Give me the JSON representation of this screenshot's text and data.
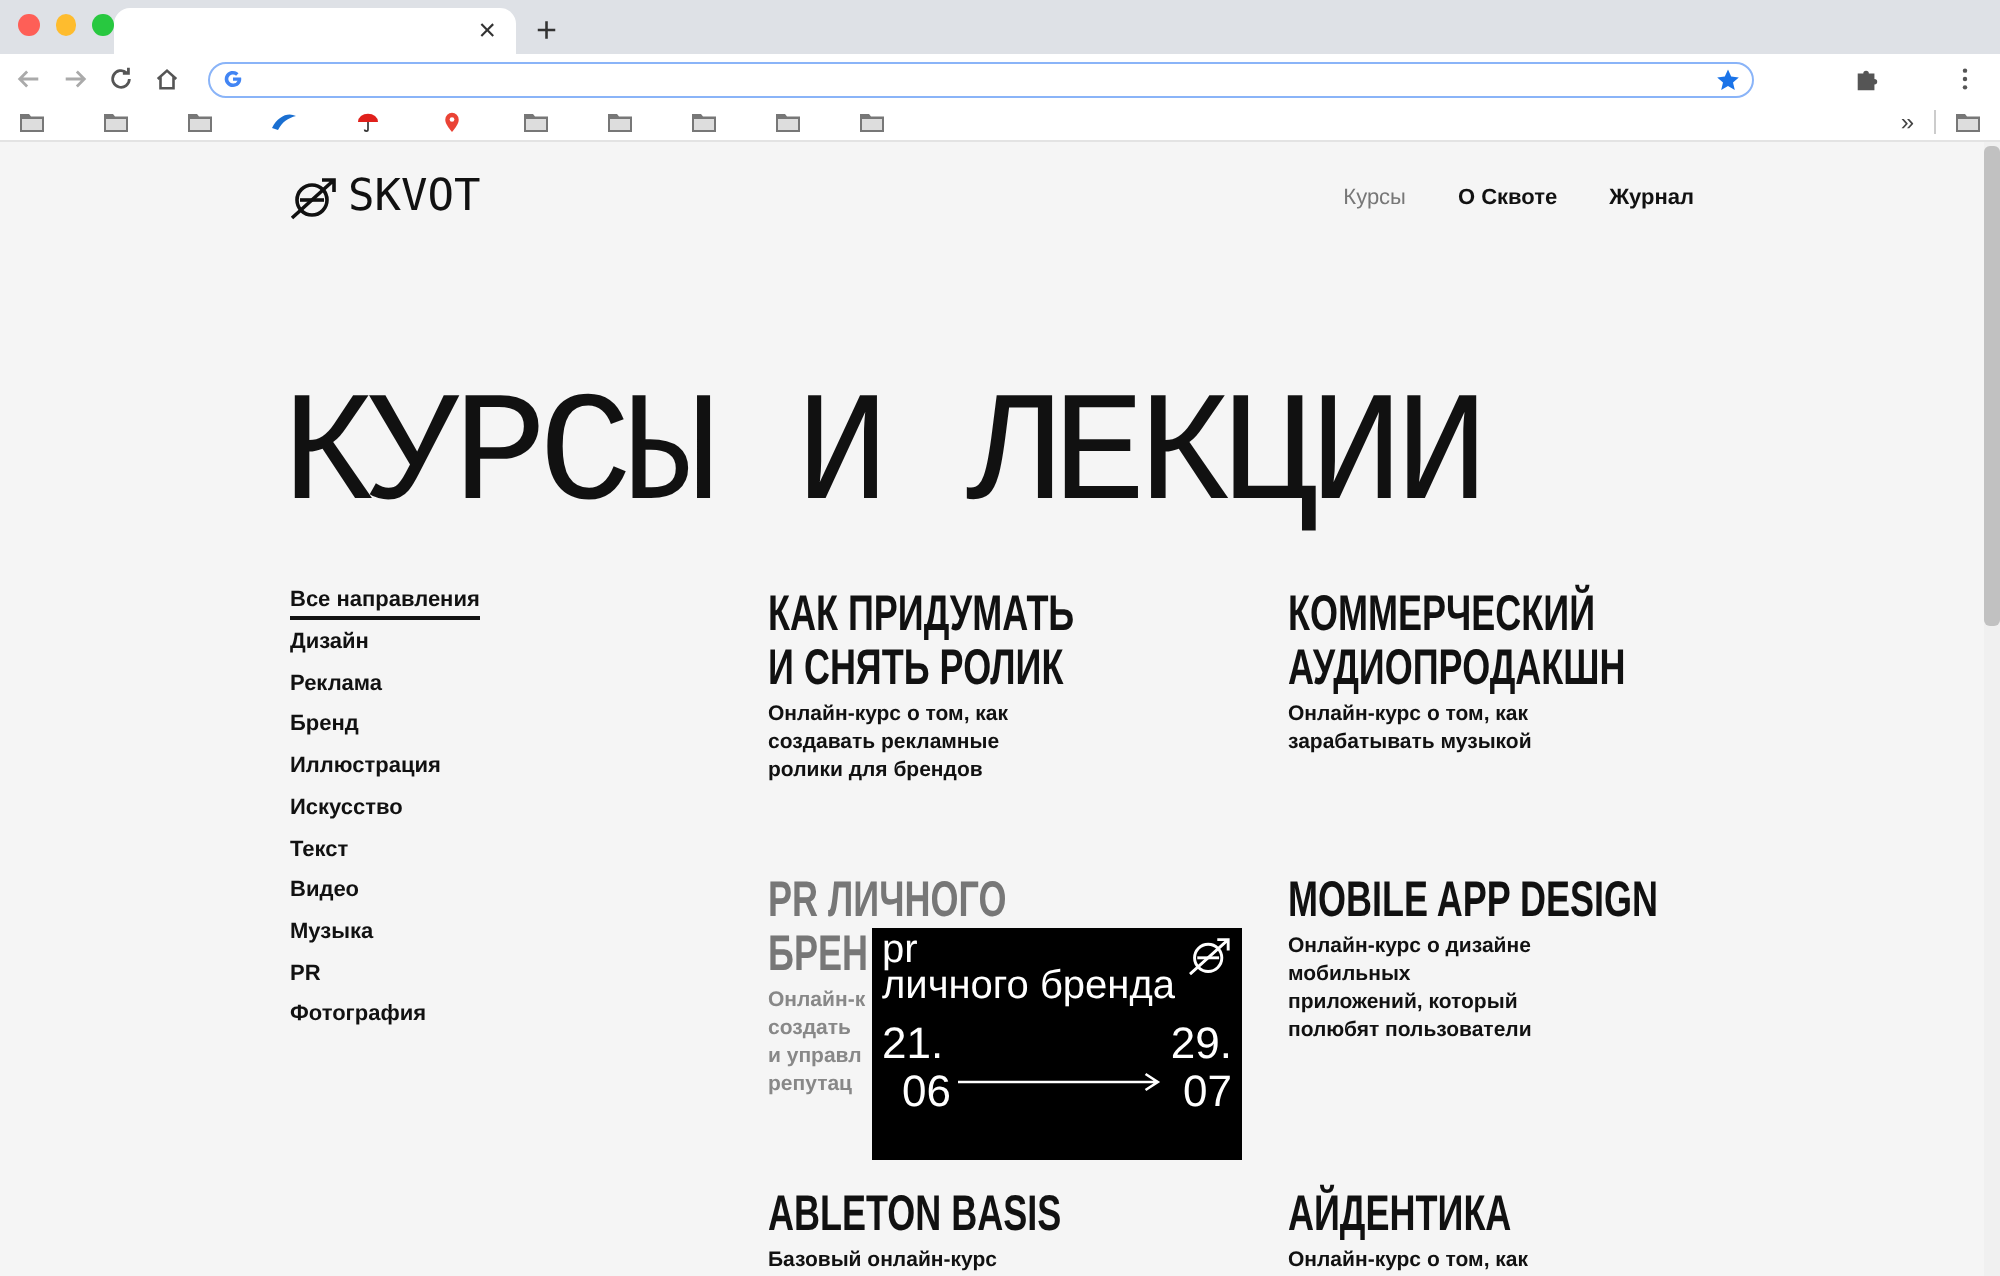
{
  "browser": {
    "tab_close": "×",
    "new_tab": "+",
    "bookmarks": [
      {
        "kind": "folder"
      },
      {
        "kind": "folder"
      },
      {
        "kind": "folder"
      },
      {
        "kind": "swoosh"
      },
      {
        "kind": "umbrella"
      },
      {
        "kind": "pin"
      },
      {
        "kind": "folder"
      },
      {
        "kind": "folder"
      },
      {
        "kind": "folder"
      },
      {
        "kind": "folder"
      },
      {
        "kind": "folder"
      }
    ],
    "overflow": "»",
    "other_bookmarks": {
      "kind": "folder"
    }
  },
  "site": {
    "logo": "SKVOT",
    "nav": [
      {
        "label": "Курсы",
        "selected": true
      },
      {
        "label": "О Сквоте",
        "selected": false
      },
      {
        "label": "Журнал",
        "selected": false
      }
    ],
    "heading": "КУРСЫ И ЛЕКЦИИ",
    "filters": [
      {
        "label": "Все направления",
        "selected": true
      },
      {
        "label": "Дизайн",
        "selected": false
      },
      {
        "label": "Реклама",
        "selected": false
      },
      {
        "label": "Бренд",
        "selected": false
      },
      {
        "label": "Иллюстрация",
        "selected": false
      },
      {
        "label": "Искусство",
        "selected": false
      },
      {
        "label": "Текст",
        "selected": false
      },
      {
        "label": "Видео",
        "selected": false
      },
      {
        "label": "Музыка",
        "selected": false
      },
      {
        "label": "PR",
        "selected": false
      },
      {
        "label": "Фотография",
        "selected": false
      }
    ],
    "courses": [
      {
        "title": [
          "КАК ПРИДУМАТЬ",
          "И СНЯТЬ РОЛИК"
        ],
        "description": [
          "Онлайн-курс о том, как",
          "создавать рекламные",
          "ролики для брендов"
        ],
        "dimmed": false
      },
      {
        "title": [
          "КОММЕРЧЕСКИЙ",
          "АУДИОПРОДАКШН"
        ],
        "description": [
          "Онлайн-курс о том, как",
          "зарабатывать музыкой"
        ],
        "dimmed": false
      },
      {
        "title": [
          "PR ЛИЧНОГО",
          "БРЕН"
        ],
        "description": [
          "Онлайн-к",
          "создать",
          "и управл",
          "репутац"
        ],
        "dimmed": true,
        "promo": {
          "title": [
            "pr",
            "личного бренда"
          ],
          "start": [
            "21.",
            "06"
          ],
          "end": [
            "29.",
            "07"
          ]
        }
      },
      {
        "title": [
          "MOBILE APP DESIGN"
        ],
        "description": [
          "Онлайн-курс о дизайне",
          "мобильных",
          "приложений, который",
          "полюбят пользователи"
        ],
        "dimmed": false
      },
      {
        "title": [
          "ABLETON BASIS"
        ],
        "description": [
          "Базовый онлайн-курс"
        ],
        "dimmed": false
      },
      {
        "title": [
          "АЙДЕНТИКА"
        ],
        "description": [
          "Онлайн-курс о том, как"
        ],
        "dimmed": false
      }
    ]
  }
}
